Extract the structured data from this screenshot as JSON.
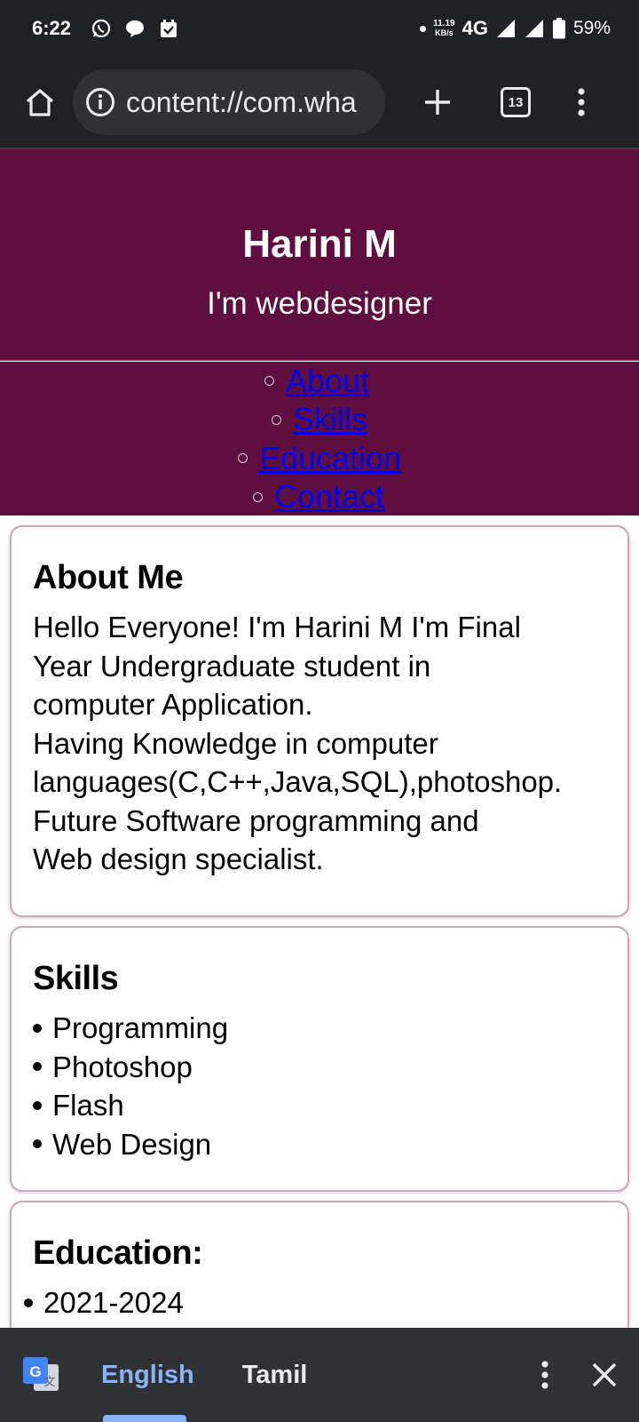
{
  "status_bar": {
    "time": "6:22",
    "net_speed_value": "11.19",
    "net_speed_unit": "KB/s",
    "network_type": "4G",
    "battery": "59%"
  },
  "browser": {
    "url": "content://com.wha",
    "tab_count": "13"
  },
  "header": {
    "name": "Harini M",
    "tagline": "I'm webdesigner"
  },
  "nav": {
    "items": [
      {
        "label": "About"
      },
      {
        "label": "Skills"
      },
      {
        "label": "Education"
      },
      {
        "label": "Contact"
      }
    ]
  },
  "about": {
    "title": "About Me",
    "lines": [
      "Hello Everyone! I'm Harini M I'm Final",
      "Year Undergraduate student in",
      "computer Application.",
      "Having Knowledge in computer",
      "languages(C,C++,Java,SQL),photoshop.",
      "Future Software programming and",
      "Web design specialist."
    ]
  },
  "skills": {
    "title": "Skills",
    "items": [
      "Programming",
      "Photoshop",
      "Flash",
      "Web Design"
    ]
  },
  "education": {
    "title": "Education:",
    "items": [
      "2021-2024"
    ]
  },
  "translate": {
    "lang_active": "English",
    "lang_other": "Tamil"
  },
  "colors": {
    "header_bg": "#5f0f3f",
    "link": "#0000ee",
    "translate_active": "#8ab4f8"
  }
}
